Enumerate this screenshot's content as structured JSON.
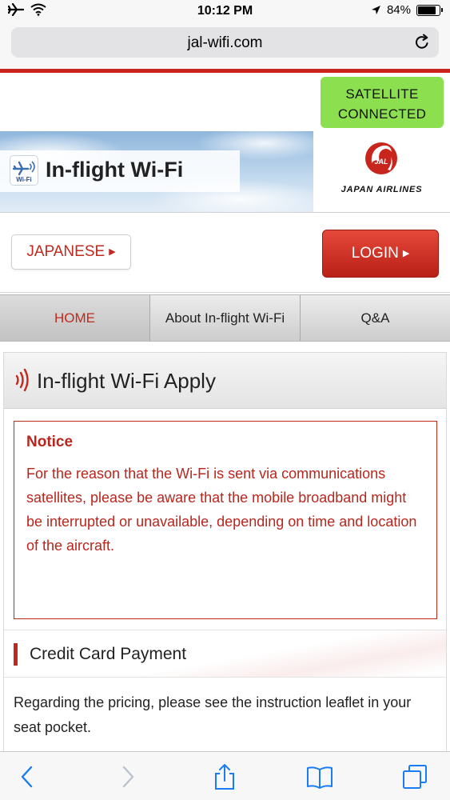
{
  "status_bar": {
    "time": "10:12 PM",
    "battery_percent": "84%",
    "battery_level": 0.84,
    "icons": [
      "airplane-icon",
      "wifi-icon",
      "location-arrow-icon",
      "battery-icon"
    ]
  },
  "browser": {
    "url": "jal-wifi.com",
    "toolbar_icons": [
      "back-icon",
      "forward-icon",
      "share-icon",
      "bookmarks-icon",
      "tabs-icon"
    ]
  },
  "header": {
    "satellite_status_line1": "SATELLITE",
    "satellite_status_line2": "CONNECTED",
    "satellite_status_color": "#8ce04f",
    "wifi_logo_label": "Wi-Fi",
    "hero_title": "In-flight Wi-Fi",
    "airline_logo_mark": "JAL",
    "airline_name": "JAPAN AIRLINES"
  },
  "actions": {
    "japanese_label": "JAPANESE",
    "login_label": "LOGIN"
  },
  "nav": {
    "tabs": [
      {
        "label": "HOME",
        "active": true
      },
      {
        "label": "About In-flight Wi-Fi",
        "active": false
      },
      {
        "label": "Q&A",
        "active": false
      }
    ]
  },
  "main": {
    "apply_title": "In-flight Wi-Fi Apply",
    "notice": {
      "title": "Notice",
      "body": "For the reason that the Wi-Fi is sent via communications satellites, please be aware that the mobile broadband might be interrupted or unavailable, depending on time and location of the aircraft."
    },
    "credit_card_title": "Credit Card Payment",
    "pricing_text": "Regarding the pricing, please see the instruction leaflet in your seat pocket."
  },
  "colors": {
    "brand_red": "#c0291d",
    "accent_green": "#8ce04f",
    "ios_blue": "#1a7cf5"
  }
}
